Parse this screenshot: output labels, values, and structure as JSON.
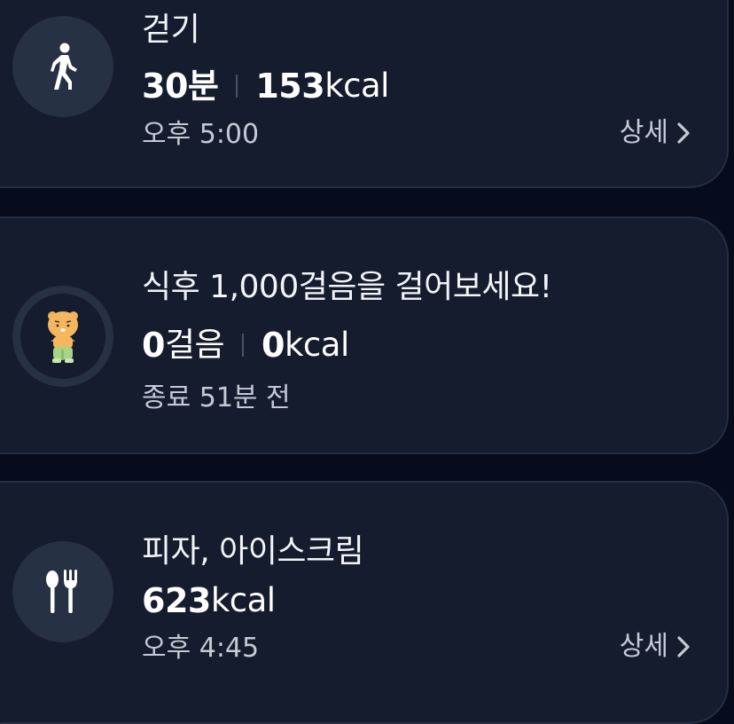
{
  "cards": [
    {
      "icon": "walking-person-icon",
      "title": "걷기",
      "stat1_num": "30",
      "stat1_unit": "분",
      "stat2_num": "153",
      "stat2_unit": "kcal",
      "time": "오후 5:00",
      "detail_label": "상세"
    },
    {
      "icon": "mascot-character-icon",
      "title": "식후 1,000걸음을 걸어보세요!",
      "stat1_num": "0",
      "stat1_unit": "걸음",
      "stat2_num": "0",
      "stat2_unit": "kcal",
      "time": "종료 51분 전"
    },
    {
      "icon": "spoon-fork-icon",
      "title": "피자, 아이스크림",
      "stat1_num": "623",
      "stat1_unit": "kcal",
      "time": "오후 4:45",
      "detail_label": "상세"
    }
  ],
  "colors": {
    "background": "#070c1c",
    "card": "#141c2e",
    "card_border": "#252e42",
    "icon_circle": "#273144",
    "muted_text": "#c5cad4"
  }
}
